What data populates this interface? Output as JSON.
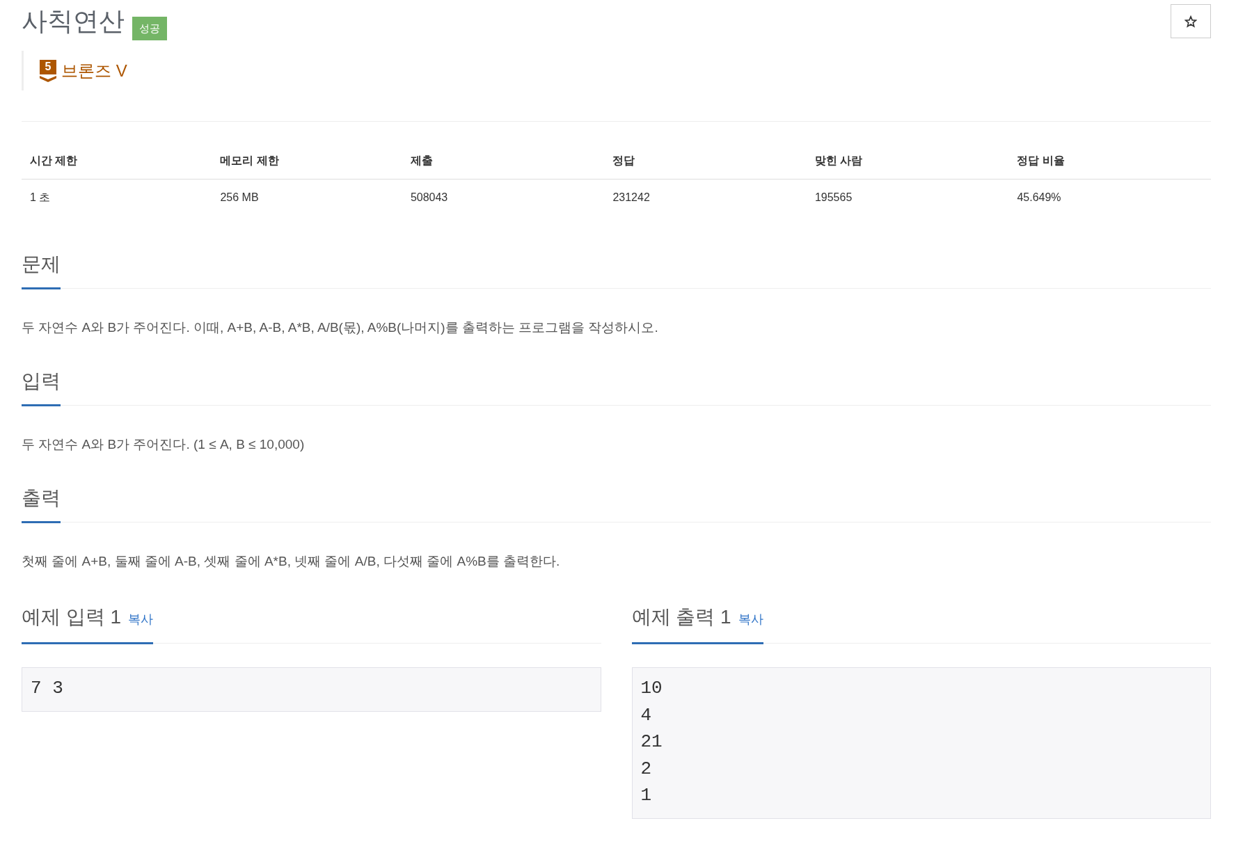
{
  "problem": {
    "title": "사칙연산",
    "status_badge": "성공"
  },
  "tier": {
    "number": "5",
    "label": "브론즈 V"
  },
  "stats_table": {
    "columns": [
      "시간 제한",
      "메모리 제한",
      "제출",
      "정답",
      "맞힌 사람",
      "정답 비율"
    ],
    "rows": [
      [
        "1 초",
        "256 MB",
        "508043",
        "231242",
        "195565",
        "45.649%"
      ]
    ]
  },
  "sections": [
    {
      "heading": "문제",
      "text": "두 자연수 A와 B가 주어진다. 이때, A+B, A-B, A*B, A/B(몫), A%B(나머지)를 출력하는 프로그램을 작성하시오."
    },
    {
      "heading": "입력",
      "text": "두 자연수 A와 B가 주어진다. (1 ≤ A, B ≤ 10,000)"
    },
    {
      "heading": "출력",
      "text": "첫째 줄에 A+B, 둘째 줄에 A-B, 셋째 줄에 A*B, 넷째 줄에 A/B, 다섯째 줄에 A%B를 출력한다."
    }
  ],
  "samples": [
    {
      "heading": "예제 입력 1",
      "copy_link": "복사",
      "lines": [
        "7 3"
      ]
    },
    {
      "heading": "예제 출력 1",
      "copy_link": "복사",
      "lines": [
        "10",
        "4",
        "21",
        "2",
        "1"
      ]
    }
  ]
}
